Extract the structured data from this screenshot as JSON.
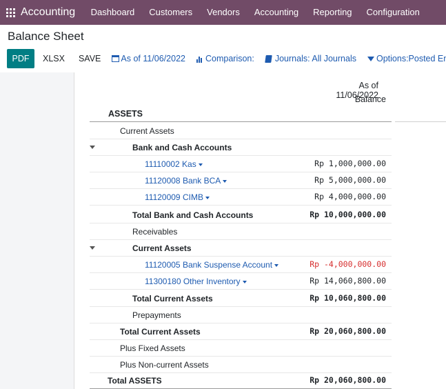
{
  "app": {
    "name": "Accounting"
  },
  "menu": [
    "Dashboard",
    "Customers",
    "Vendors",
    "Accounting",
    "Reporting",
    "Configuration"
  ],
  "page": {
    "title": "Balance Sheet"
  },
  "toolbar": {
    "pdf": "PDF",
    "xlsx": "XLSX",
    "save": "SAVE",
    "date_filter": "As of 11/06/2022",
    "comparison": "Comparison:",
    "journals": "Journals: All Journals",
    "options": "Options:Posted Entries"
  },
  "report": {
    "header_date": "As of 11/06/2022",
    "header_balance": "Balance",
    "section": "ASSETS",
    "rows": [
      {
        "label": "Current Assets",
        "amount": ""
      },
      {
        "label": "Bank and Cash Accounts",
        "amount": ""
      },
      {
        "label": "11110002 Kas",
        "amount": "Rp 1,000,000.00"
      },
      {
        "label": "11120008 Bank BCA",
        "amount": "Rp 5,000,000.00"
      },
      {
        "label": "11120009 CIMB",
        "amount": "Rp 4,000,000.00"
      },
      {
        "label": "Total Bank and Cash Accounts",
        "amount": "Rp 10,000,000.00"
      },
      {
        "label": "Receivables",
        "amount": ""
      },
      {
        "label": "Current Assets",
        "amount": ""
      },
      {
        "label": "11120005 Bank Suspense Account",
        "amount": "Rp -4,000,000.00"
      },
      {
        "label": "11300180 Other Inventory",
        "amount": "Rp 14,060,800.00"
      },
      {
        "label": "Total Current Assets",
        "amount": "Rp 10,060,800.00"
      },
      {
        "label": "Prepayments",
        "amount": ""
      },
      {
        "label": "Total Current Assets",
        "amount": "Rp 20,060,800.00"
      },
      {
        "label": "Plus Fixed Assets",
        "amount": ""
      },
      {
        "label": "Plus Non-current Assets",
        "amount": ""
      },
      {
        "label": "Total ASSETS",
        "amount": "Rp 20,060,800.00"
      }
    ]
  },
  "colors": {
    "topbar": "#714b67",
    "primary_button": "#017e84",
    "link": "#1e5bb0",
    "negative": "#d62e2e"
  }
}
